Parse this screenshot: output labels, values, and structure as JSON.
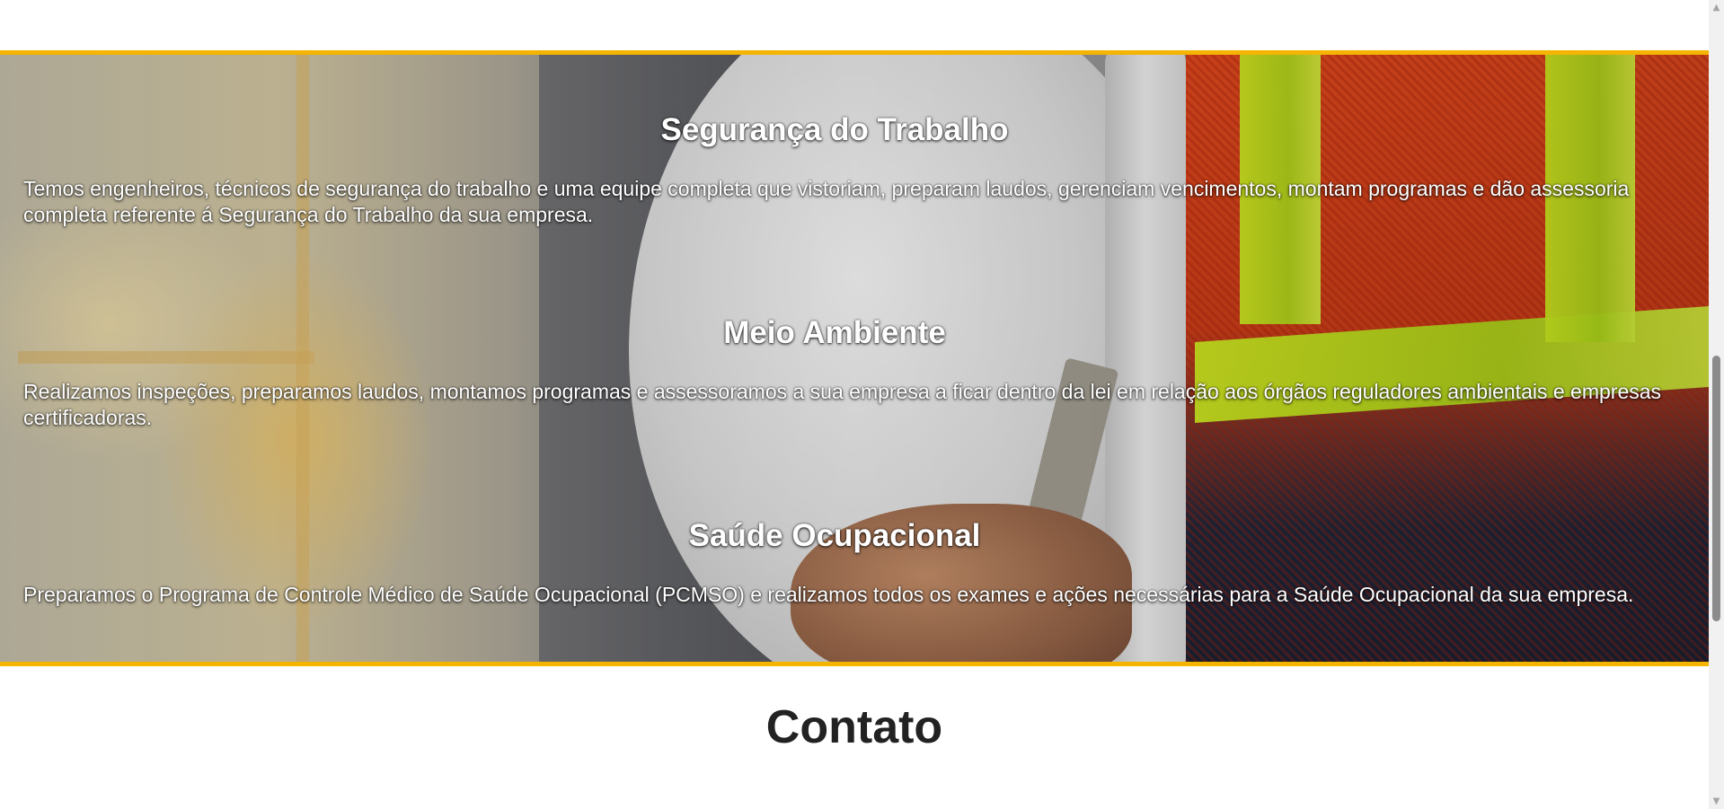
{
  "services": [
    {
      "title": "Segurança do Trabalho",
      "description": "Temos engenheiros, técnicos de segurança do trabalho e uma equipe completa que vistoriam, preparam laudos, gerenciam vencimentos, montam programas e dão assessoria completa referente á Segurança do Trabalho da sua empresa."
    },
    {
      "title": "Meio Ambiente",
      "description": "Realizamos inspeções, preparamos laudos, montamos programas e assessoramos a sua empresa a ficar dentro da lei em relação aos órgãos reguladores ambientais e empresas certificadoras."
    },
    {
      "title": "Saúde Ocupacional",
      "description": "Preparamos o Programa de Controle Médico de Saúde Ocupacional (PCMSO) e realizamos todos os exames e ações necessárias para a Saúde Ocupacional da sua empresa."
    }
  ],
  "contact": {
    "title": "Contato"
  },
  "colors": {
    "accent_border": "#f5b400",
    "heading_dark": "#222222",
    "service_text": "#ffffff"
  },
  "scrollbar": {
    "up_icon": "▲",
    "down_icon": "▼"
  }
}
